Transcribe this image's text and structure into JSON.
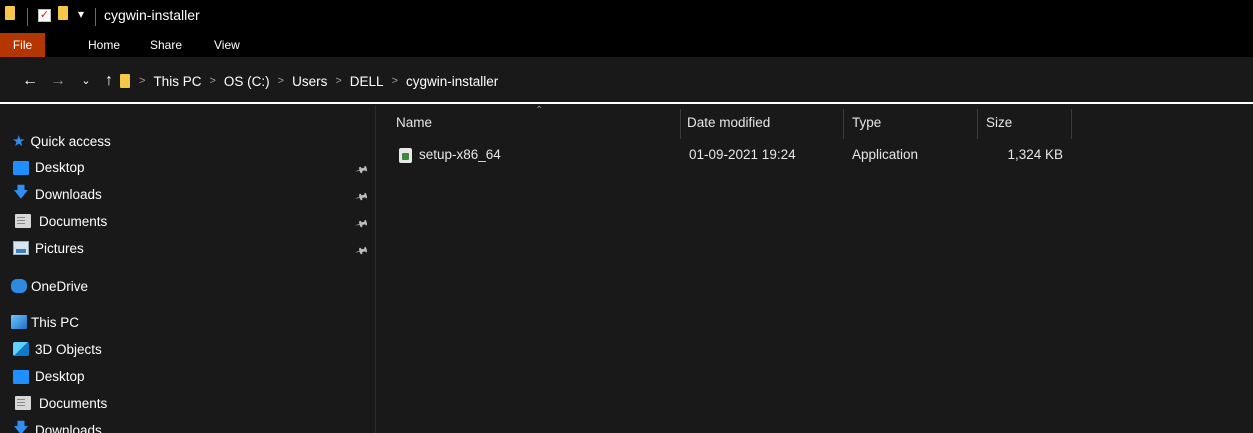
{
  "window": {
    "title": "cygwin-installer"
  },
  "ribbon": {
    "tabs": [
      "File",
      "Home",
      "Share",
      "View"
    ]
  },
  "address": {
    "crumbs": [
      "This PC",
      "OS (C:)",
      "Users",
      "DELL",
      "cygwin-installer"
    ]
  },
  "navpane": {
    "quick_access": "Quick access",
    "quick_items": [
      "Desktop",
      "Downloads",
      "Documents",
      "Pictures"
    ],
    "onedrive": "OneDrive",
    "this_pc": "This PC",
    "pc_items": [
      "3D Objects",
      "Desktop",
      "Documents",
      "Downloads"
    ]
  },
  "filelist": {
    "columns": {
      "name": "Name",
      "date": "Date modified",
      "type": "Type",
      "size": "Size"
    },
    "rows": [
      {
        "name": "setup-x86_64",
        "date": "01-09-2021 19:24",
        "type": "Application",
        "size": "1,324 KB"
      }
    ]
  },
  "colors": {
    "background": "#191919",
    "titlebar": "#000000",
    "file_tab": "#b33600",
    "accent_blue": "#1e90ff"
  }
}
